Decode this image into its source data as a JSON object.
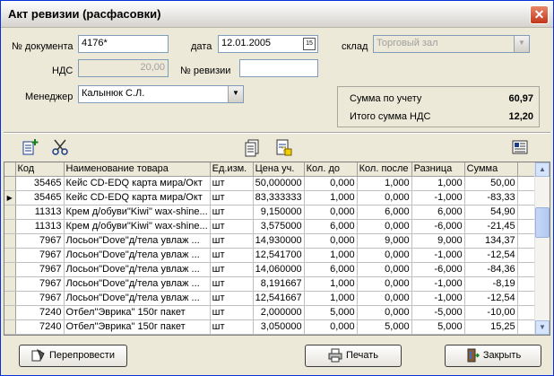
{
  "window": {
    "title": "Акт ревизии (расфасовки)"
  },
  "form": {
    "doc_number_label": "№ документа",
    "doc_number_value": "4176*",
    "date_label": "дата",
    "date_value": "12.01.2005",
    "warehouse_label": "склад",
    "warehouse_value": "Торговый зал",
    "vat_label": "НДС",
    "vat_value": "20,00",
    "revision_label": "№ ревизии",
    "revision_value": "",
    "manager_label": "Менеджер",
    "manager_value": "Калынюк С.Л."
  },
  "summary": {
    "accounting_label": "Сумма по учету",
    "accounting_value": "60,97",
    "vat_total_label": "Итого сумма НДС",
    "vat_total_value": "12,20"
  },
  "toolbar": {
    "icons": [
      "add-document-icon",
      "cut-icon",
      "document-icon",
      "calculate-icon",
      "report-icon"
    ]
  },
  "table": {
    "headers": [
      "Код",
      "Наименование товара",
      "Ед.изм.",
      "Цена уч.",
      "Кол. до",
      "Кол. после",
      "Разница",
      "Сумма"
    ],
    "rows": [
      [
        "35465",
        "Кейс CD-EDQ карта мира/Окт",
        "шт",
        "50,000000",
        "0,000",
        "1,000",
        "1,000",
        "50,00"
      ],
      [
        "35465",
        "Кейс CD-EDQ карта мира/Окт",
        "шт",
        "83,333333",
        "1,000",
        "0,000",
        "-1,000",
        "-83,33"
      ],
      [
        "11313",
        "Крем д/обуви\"Kiwi\" wax-shine...",
        "шт",
        "9,150000",
        "0,000",
        "6,000",
        "6,000",
        "54,90"
      ],
      [
        "11313",
        "Крем д/обуви\"Kiwi\" wax-shine...",
        "шт",
        "3,575000",
        "6,000",
        "0,000",
        "-6,000",
        "-21,45"
      ],
      [
        "7967",
        "Лосьон\"Dove\"д/тела увлаж ...",
        "шт",
        "14,930000",
        "0,000",
        "9,000",
        "9,000",
        "134,37"
      ],
      [
        "7967",
        "Лосьон\"Dove\"д/тела увлаж ...",
        "шт",
        "12,541700",
        "1,000",
        "0,000",
        "-1,000",
        "-12,54"
      ],
      [
        "7967",
        "Лосьон\"Dove\"д/тела увлаж ...",
        "шт",
        "14,060000",
        "6,000",
        "0,000",
        "-6,000",
        "-84,36"
      ],
      [
        "7967",
        "Лосьон\"Dove\"д/тела увлаж ...",
        "шт",
        "8,191667",
        "1,000",
        "0,000",
        "-1,000",
        "-8,19"
      ],
      [
        "7967",
        "Лосьон\"Dove\"д/тела увлаж ...",
        "шт",
        "12,541667",
        "1,000",
        "0,000",
        "-1,000",
        "-12,54"
      ],
      [
        "7240",
        "Отбел\"Эврика\" 150г пакет",
        "шт",
        "2,000000",
        "5,000",
        "0,000",
        "-5,000",
        "-10,00"
      ],
      [
        "7240",
        "Отбел\"Эврика\" 150г пакет",
        "шт",
        "3,050000",
        "0,000",
        "5,000",
        "5,000",
        "15,25"
      ]
    ],
    "current_row": 1
  },
  "buttons": {
    "repost": "Перепровести",
    "print": "Печать",
    "close": "Закрыть"
  }
}
